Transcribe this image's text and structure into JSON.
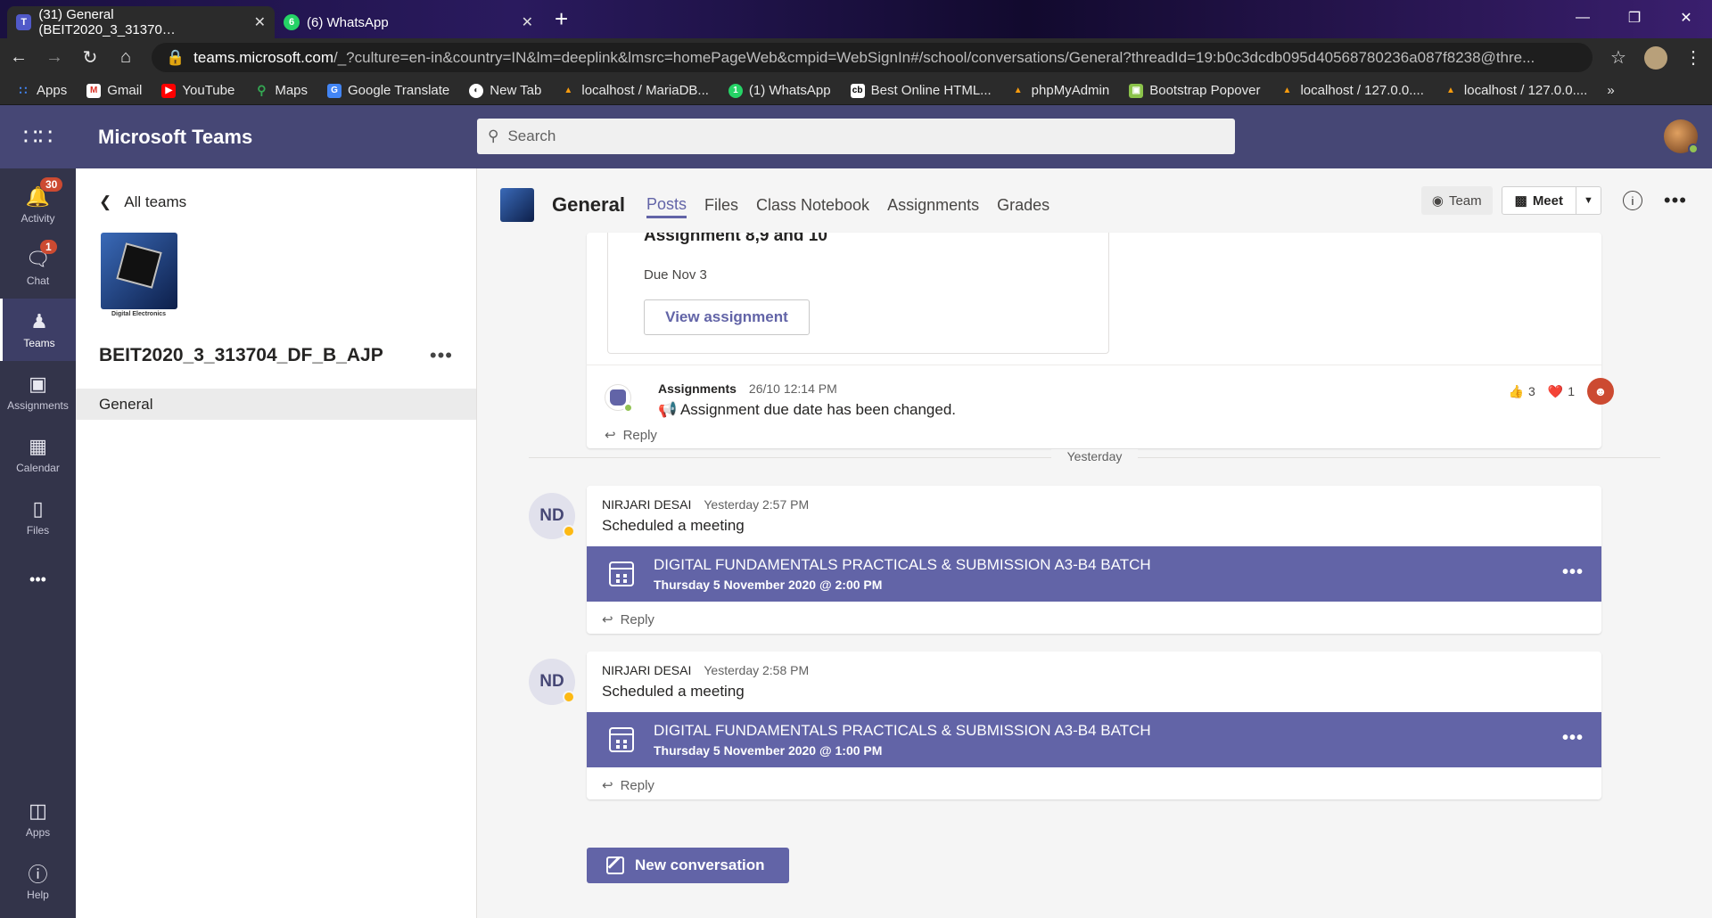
{
  "browser": {
    "tabs": [
      {
        "title": "(31) General (BEIT2020_3_31370…",
        "close": "✕"
      },
      {
        "title": "(6) WhatsApp",
        "close": "✕"
      }
    ],
    "url_host": "teams.microsoft.com",
    "url_rest": "/_?culture=en-in&country=IN&lm=deeplink&lmsrc=homePageWeb&cmpid=WebSignIn#/school/conversations/General?threadId=19:b0c3dcdb095d40568780236a087f8238@thre...",
    "bookmarks": [
      "Apps",
      "Gmail",
      "YouTube",
      "Maps",
      "Google Translate",
      "New Tab",
      "localhost / MariaDB...",
      "(1) WhatsApp",
      "Best Online HTML...",
      "phpMyAdmin",
      "Bootstrap Popover",
      "localhost / 127.0.0....",
      "localhost / 127.0.0...."
    ],
    "bookmarks_more": "»"
  },
  "header": {
    "app_name": "Microsoft Teams",
    "search_placeholder": "Search"
  },
  "rail": {
    "items": [
      {
        "label": "Activity",
        "badge": "30"
      },
      {
        "label": "Chat",
        "badge": "1"
      },
      {
        "label": "Teams"
      },
      {
        "label": "Assignments"
      },
      {
        "label": "Calendar"
      },
      {
        "label": "Files"
      }
    ],
    "more": "•••",
    "bottom": [
      {
        "label": "Apps"
      },
      {
        "label": "Help"
      }
    ]
  },
  "sidebar": {
    "back_label": "All teams",
    "team_image_caption": "Digital Electronics",
    "team_name": "BEIT2020_3_313704_DF_B_AJP",
    "more": "•••",
    "channels": [
      "General"
    ]
  },
  "channel": {
    "title": "General",
    "tabs": [
      "Posts",
      "Files",
      "Class Notebook",
      "Assignments",
      "Grades"
    ],
    "team_button": "Team",
    "meet_button": "Meet",
    "more": "•••"
  },
  "feed": {
    "assignment": {
      "title": "Assignment 8,9 and 10",
      "due": "Due Nov 3",
      "view_button": "View assignment",
      "author": "Assignments",
      "time": "26/10 12:14 PM",
      "message": "📢 Assignment due date has been changed.",
      "reactions": [
        {
          "icon": "👍",
          "count": "3"
        },
        {
          "icon": "❤️",
          "count": "1"
        }
      ],
      "reply": "Reply"
    },
    "divider": "Yesterday",
    "meetings": [
      {
        "initials": "ND",
        "author": "NIRJARI DESAI",
        "time": "Yesterday 2:57 PM",
        "message": "Scheduled a meeting",
        "meeting_title": "DIGITAL FUNDAMENTALS PRACTICALS & SUBMISSION A3-B4 BATCH",
        "meeting_date": "Thursday 5 November 2020 @ 2:00 PM",
        "reply": "Reply"
      },
      {
        "initials": "ND",
        "author": "NIRJARI DESAI",
        "time": "Yesterday 2:58 PM",
        "message": "Scheduled a meeting",
        "meeting_title": "DIGITAL FUNDAMENTALS PRACTICALS & SUBMISSION A3-B4 BATCH",
        "meeting_date": "Thursday 5 November 2020 @ 1:00 PM",
        "reply": "Reply"
      }
    ],
    "new_conversation": "New conversation"
  },
  "colors": {
    "brand": "#6264a7",
    "header": "#464775",
    "rail": "#33344a",
    "badge": "#cc4a31"
  }
}
